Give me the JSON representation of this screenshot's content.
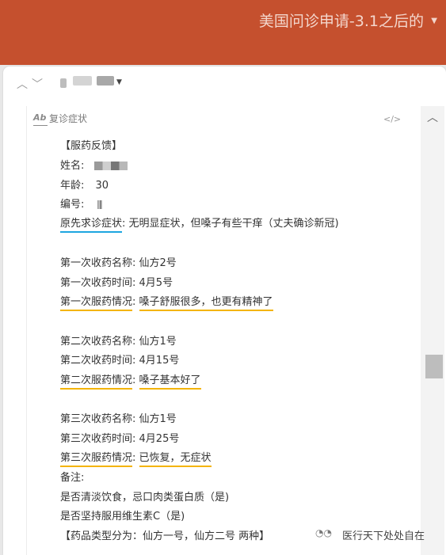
{
  "window": {
    "title": "美国问诊申请-3.1之后的"
  },
  "note": {
    "header_label": "复诊症状",
    "lines": {
      "feedback_title": "【服药反馈】",
      "name_label": "姓名:",
      "age_label": "年龄:",
      "age_value": "30",
      "id_label": "编号:",
      "symptom_label": "原先求诊症状",
      "symptom_value": ": 无明显症状，但嗓子有些干痒（丈夫确诊新冠)",
      "r1_name_label": "第一次收药名称:",
      "r1_name_value": "仙方2号",
      "r1_time_label": "第一次收药时间:",
      "r1_time_value": "4月5号",
      "r1_status_label": "第一次服药情况",
      "r1_status_value": "嗓子舒服很多，也更有精神了",
      "r2_name_label": "第二次收药名称:",
      "r2_name_value": "仙方1号",
      "r2_time_label": "第二次收药时间:",
      "r2_time_value": "4月15号",
      "r2_status_label": "第二次服药情况",
      "r2_status_value": "嗓子基本好了",
      "r3_name_label": "第三次收药名称:",
      "r3_name_value": "仙方1号",
      "r3_time_label": "第三次收药时间:",
      "r3_time_value": "4月25号",
      "r3_status_label": "第三次服药情况",
      "r3_status_value": "已恢复，无症状",
      "remarks_label": "备注:",
      "diet_question": "是否清淡饮食，忌口肉类蛋白质（是)",
      "vitc_question": "是否坚持服用维生素C（是)",
      "types_line": "【药品类型分为：仙方一号，仙方二号 两种】"
    }
  },
  "watermark": {
    "text": "医行天下处处自在"
  },
  "colors": {
    "topbar": "#c5502e",
    "underline_blue": "#1ea6e0",
    "underline_yellow": "#f4b400"
  }
}
